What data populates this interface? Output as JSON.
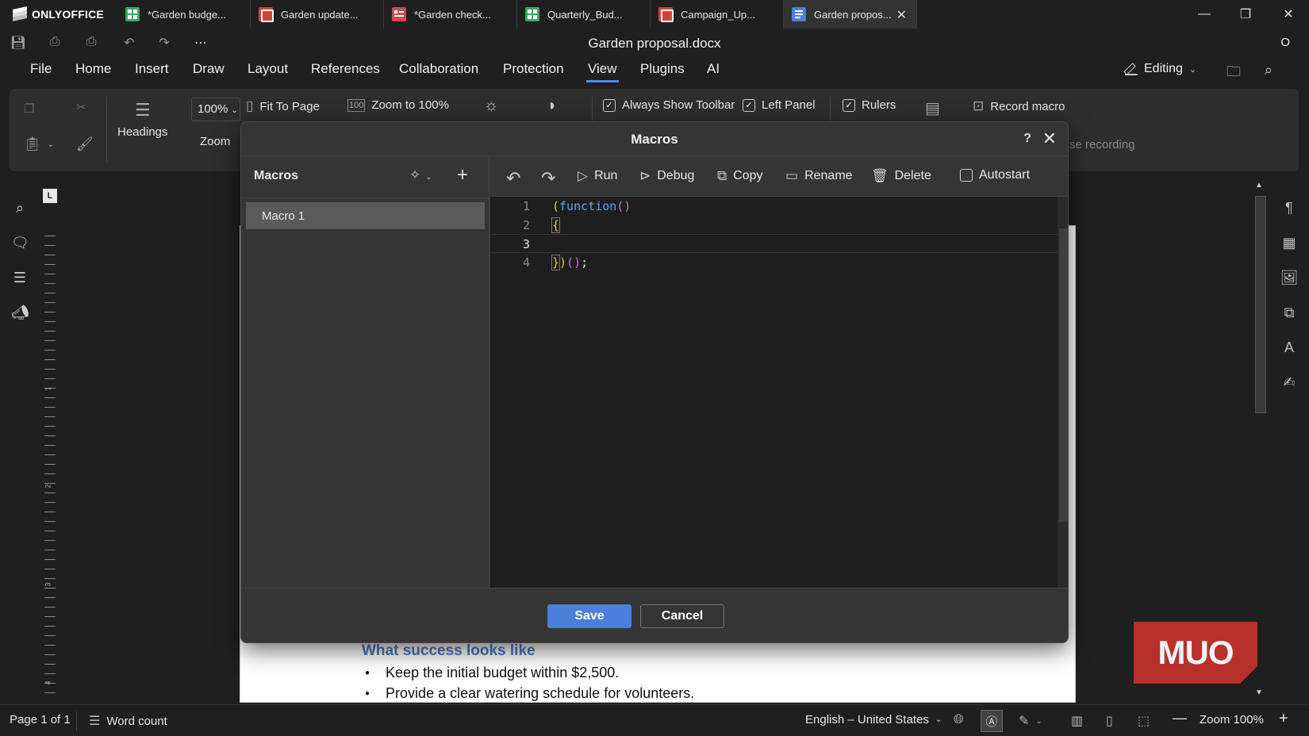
{
  "app": {
    "brand": "ONLYOFFICE",
    "doc_title": "Garden proposal.docx",
    "user_initial": "O"
  },
  "tabs": [
    {
      "label": "*Garden budge...",
      "type": "cell"
    },
    {
      "label": "Garden update...",
      "type": "slide"
    },
    {
      "label": "*Garden check...",
      "type": "form"
    },
    {
      "label": "Quarterly_Bud...",
      "type": "cell"
    },
    {
      "label": "Campaign_Up...",
      "type": "slide"
    },
    {
      "label": "Garden propos...",
      "type": "word",
      "active": true
    }
  ],
  "menu": {
    "items": [
      "File",
      "Home",
      "Insert",
      "Draw",
      "Layout",
      "References",
      "Collaboration",
      "Protection",
      "View",
      "Plugins",
      "AI"
    ],
    "active": "View",
    "mode": "Editing"
  },
  "ribbon": {
    "headings": "Headings",
    "zoom_value": "100%",
    "zoom_label": "Zoom",
    "fit_to_page": "Fit To Page",
    "zoom_100": "Zoom to 100%",
    "always_show_toolbar": "Always Show Toolbar",
    "left_panel": "Left Panel",
    "rulers": "Rulers",
    "record_macro": "Record macro",
    "pause_recording_partial": "se recording",
    "ruler_tab": "L"
  },
  "dialog": {
    "title": "Macros",
    "help": "?",
    "list_title": "Macros",
    "macros": [
      "Macro 1"
    ],
    "toolbar": {
      "run": "Run",
      "debug": "Debug",
      "copy": "Copy",
      "rename": "Rename",
      "delete": "Delete",
      "autostart": "Autostart"
    },
    "code_lines": [
      {
        "n": "1",
        "text": "(function()"
      },
      {
        "n": "2",
        "text": "{"
      },
      {
        "n": "3",
        "text": ""
      },
      {
        "n": "4",
        "text": "})();"
      }
    ],
    "save": "Save",
    "cancel": "Cancel"
  },
  "document": {
    "heading": "What success looks like",
    "bullets": [
      "Keep the initial budget within $2,500.",
      "Provide a clear watering schedule for volunteers."
    ]
  },
  "ruler_numbers": [
    "1",
    "2",
    "3",
    "4"
  ],
  "watermark": "MUO",
  "statusbar": {
    "page": "Page 1 of 1",
    "word_count": "Word count",
    "language": "English – United States",
    "zoom": "Zoom 100%"
  },
  "colors": {
    "accent": "#4a7fdc",
    "tab_active_underline": "#4a8cf0",
    "heading_blue": "#4a78c2",
    "watermark": "#b8302c"
  }
}
